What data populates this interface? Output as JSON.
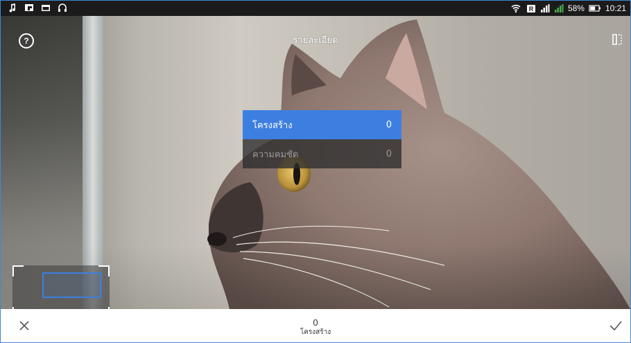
{
  "status_bar": {
    "icons_left": [
      "music-icon",
      "flipboard-icon",
      "image-icon",
      "headphones-icon"
    ],
    "icons_right": [
      "wifi-icon",
      "nfc-icon",
      "signal-icon",
      "signal-icon"
    ],
    "battery_text": "58%",
    "time": "10:21"
  },
  "header": {
    "title": "รายละเอียด",
    "help_icon": "help-circle-icon",
    "compare_icon": "compare-icon"
  },
  "adjust_menu": {
    "items": [
      {
        "label": "โครงสร้าง",
        "value": "0",
        "selected": true
      },
      {
        "label": "ความคมชัด",
        "value": "0",
        "selected": false
      }
    ]
  },
  "bottom_bar": {
    "value": "0",
    "label": "โครงสร้าง",
    "cancel_icon": "close-icon",
    "apply_icon": "check-icon"
  },
  "colors": {
    "accent": "#3d7fe0",
    "status_bar_bg": "#1b1b1b",
    "frame_border": "#3c8ad8"
  }
}
